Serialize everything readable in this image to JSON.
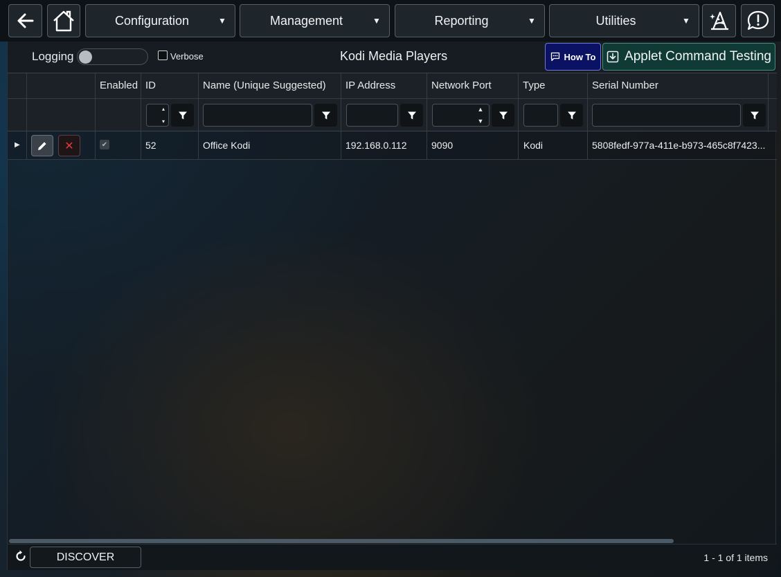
{
  "nav": {
    "menus": [
      {
        "label": "Configuration"
      },
      {
        "label": "Management"
      },
      {
        "label": "Reporting"
      },
      {
        "label": "Utilities"
      }
    ]
  },
  "toolbar": {
    "logging_label": "Logging",
    "logging_on": false,
    "verbose_label": "Verbose",
    "verbose_checked": false,
    "title": "Kodi Media Players",
    "howto_label": "How To",
    "applet_label": "Applet Command Testing"
  },
  "grid": {
    "columns": [
      "Enabled",
      "ID",
      "Name (Unique Suggested)",
      "IP Address",
      "Network Port",
      "Type",
      "Serial Number"
    ],
    "rows": [
      {
        "enabled": true,
        "id": "52",
        "name": "Office Kodi",
        "ip": "192.168.0.112",
        "port": "9090",
        "type": "Kodi",
        "serial": "5808fedf-977a-411e-b973-465c8f7423..."
      }
    ]
  },
  "footer": {
    "discover_label": "DISCOVER",
    "pager_text": "1 - 1 of 1 items"
  },
  "colors": {
    "howto_bg": "#0b1263",
    "applet_bg": "#103a35",
    "delete_red": "#e03a3a"
  }
}
